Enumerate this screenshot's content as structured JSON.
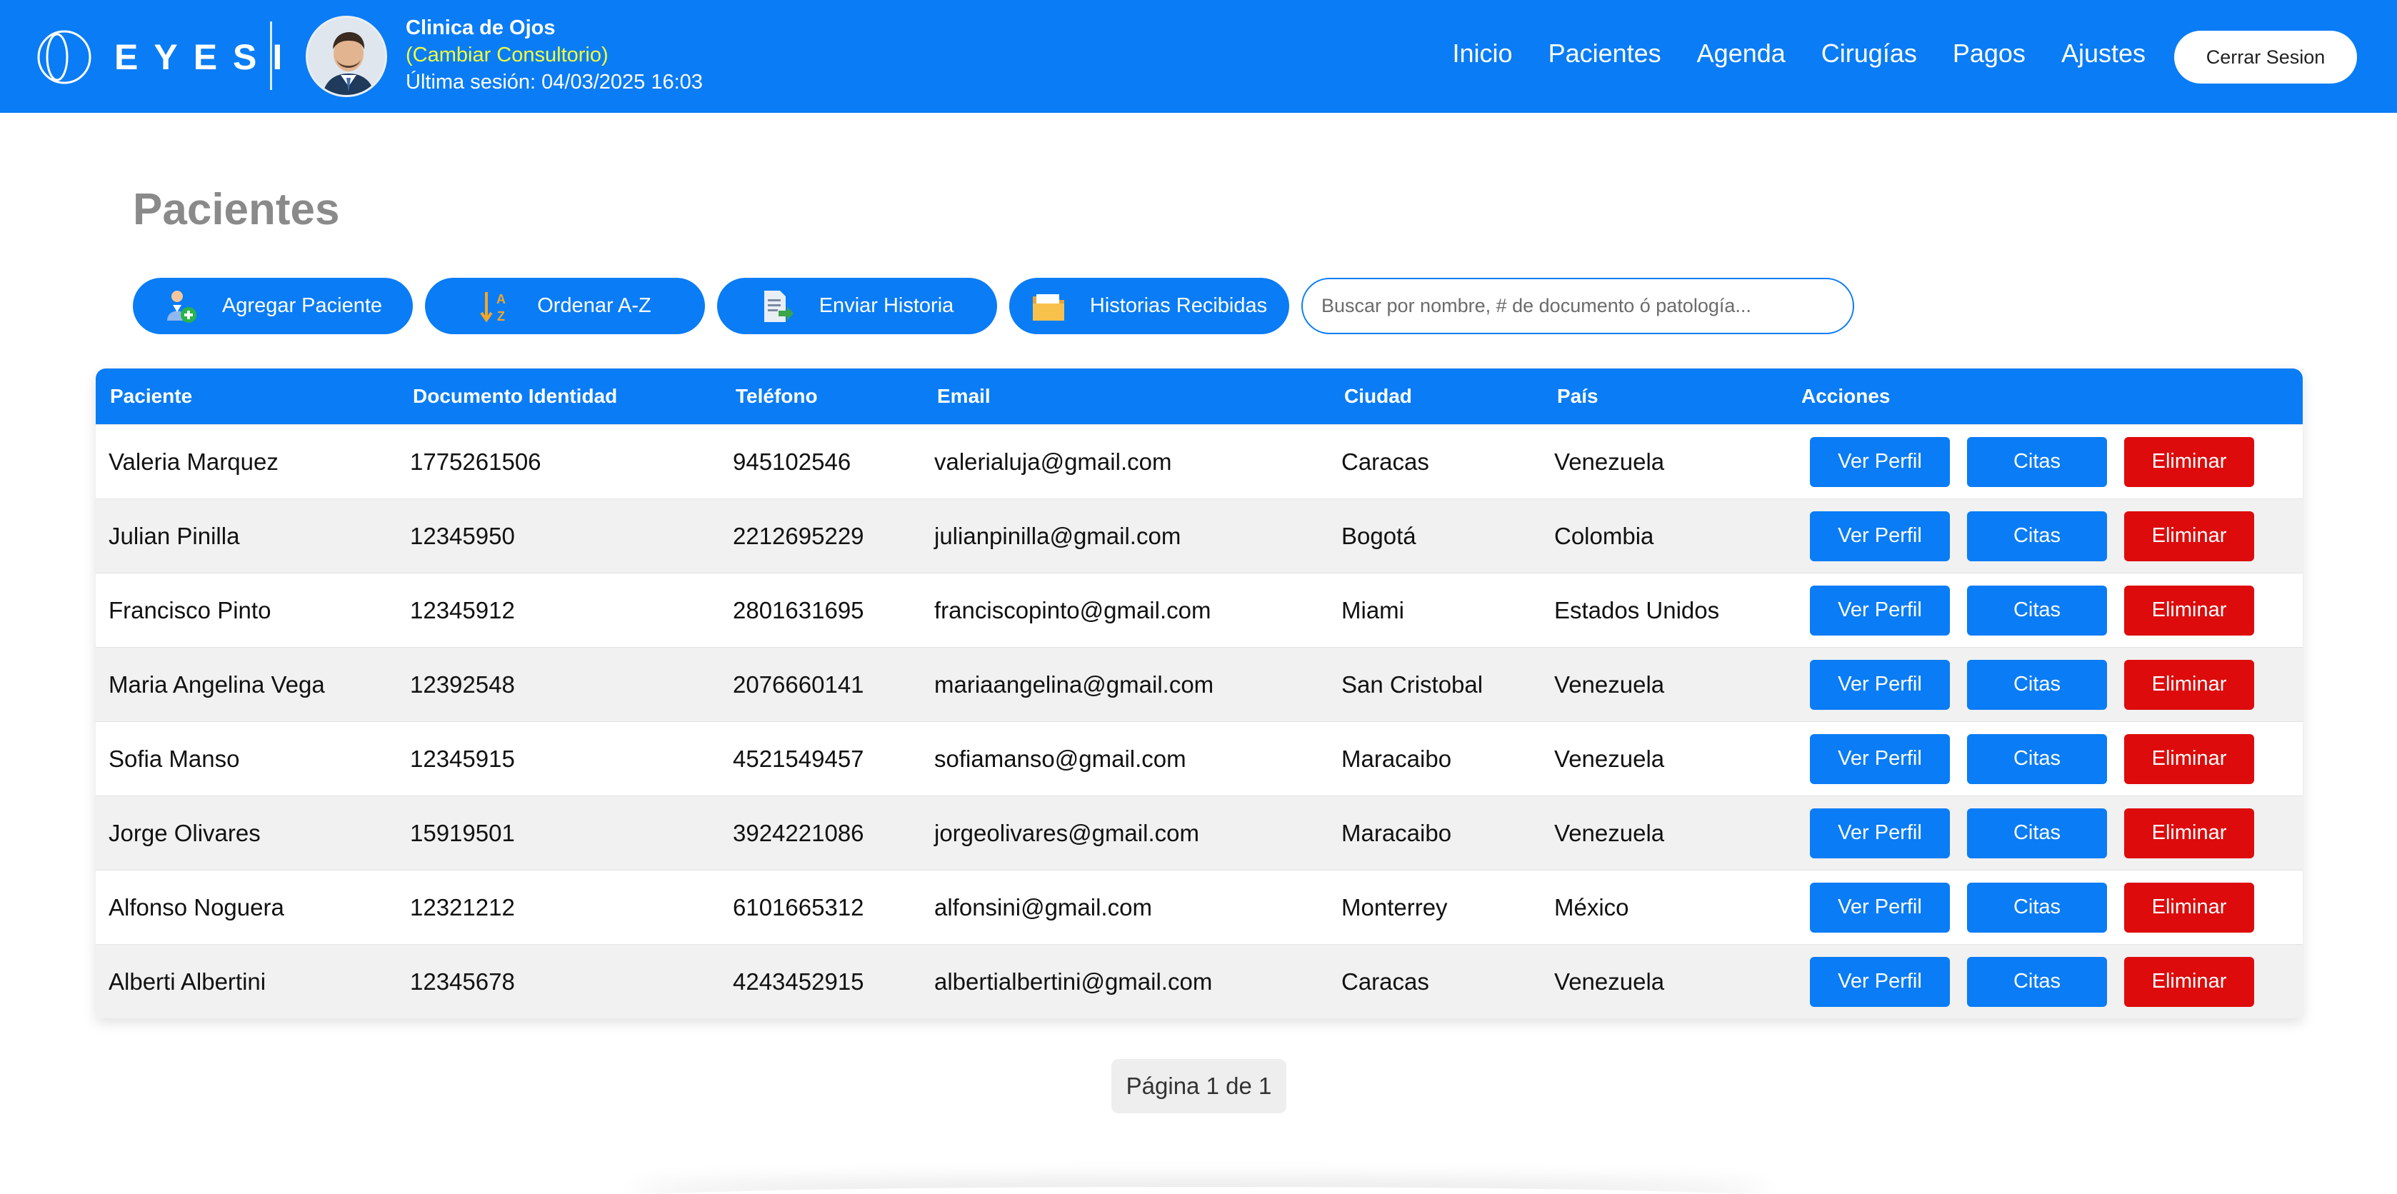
{
  "header": {
    "brand": "EYESI",
    "clinic_name": "Clinica de Ojos",
    "change_office": "(Cambiar Consultorio)",
    "last_session": "Última sesión: 04/03/2025 16:03",
    "nav": [
      "Inicio",
      "Pacientes",
      "Agenda",
      "Cirugías",
      "Pagos",
      "Ajustes"
    ],
    "logout": "Cerrar Sesion"
  },
  "page": {
    "title": "Pacientes"
  },
  "toolbar": {
    "add": "Agregar Paciente",
    "sort": "Ordenar A-Z",
    "send": "Enviar Historia",
    "received": "Historias Recibidas",
    "search_placeholder": "Buscar por nombre, # de documento ó patología..."
  },
  "table": {
    "headers": [
      "Paciente",
      "Documento Identidad",
      "Teléfono",
      "Email",
      "Ciudad",
      "País",
      "Acciones"
    ],
    "actions": {
      "view": "Ver Perfil",
      "appointments": "Citas",
      "delete": "Eliminar"
    },
    "rows": [
      [
        "Valeria Marquez",
        "1775261506",
        "945102546",
        "valerialuja@gmail.com",
        "Caracas",
        "Venezuela"
      ],
      [
        "Julian Pinilla",
        "12345950",
        "2212695229",
        "julianpinilla@gmail.com",
        "Bogotá",
        "Colombia"
      ],
      [
        "Francisco Pinto",
        "12345912",
        "2801631695",
        "franciscopinto@gmail.com",
        "Miami",
        "Estados Unidos"
      ],
      [
        "Maria Angelina Vega",
        "12392548",
        "2076660141",
        "mariaangelina@gmail.com",
        "San Cristobal",
        "Venezuela"
      ],
      [
        "Sofia Manso",
        "12345915",
        "4521549457",
        "sofiamanso@gmail.com",
        "Maracaibo",
        "Venezuela"
      ],
      [
        "Jorge Olivares",
        "15919501",
        "3924221086",
        "jorgeolivares@gmail.com",
        "Maracaibo",
        "Venezuela"
      ],
      [
        "Alfonso Noguera",
        "12321212",
        "6101665312",
        "alfonsini@gmail.com",
        "Monterrey",
        "México"
      ],
      [
        "Alberti Albertini",
        "12345678",
        "4243452915",
        "albertialbertini@gmail.com",
        "Caracas",
        "Venezuela"
      ]
    ]
  },
  "pager": "Página 1 de 1",
  "colors": {
    "primary": "#0a7cf5",
    "danger": "#dd0b0b",
    "accent_yellow": "#f3ff3a",
    "title_gray": "#8a8a8a"
  },
  "icons": [
    "logo-icon",
    "avatar",
    "add-user-icon",
    "sort-az-icon",
    "send-document-icon",
    "folder-icon"
  ]
}
